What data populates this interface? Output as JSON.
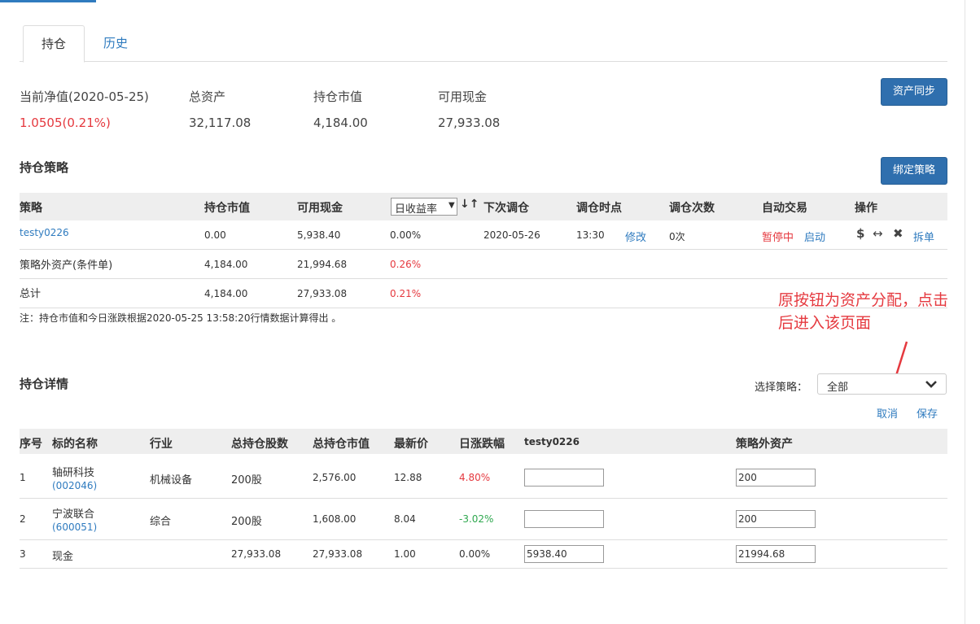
{
  "tabs": {
    "holding": "持仓",
    "history": "历史"
  },
  "summary": {
    "nav_label": "当前净值(2020-05-25)",
    "nav_value": "1.0505(0.21%)",
    "total_assets_label": "总资产",
    "total_assets_value": "32,117.08",
    "market_value_label": "持仓市值",
    "market_value_value": "4,184.00",
    "cash_label": "可用现金",
    "cash_value": "27,933.08"
  },
  "buttons": {
    "asset_sync": "资产同步",
    "bind_strategy": "绑定策略",
    "cancel": "取消",
    "save": "保存"
  },
  "strategy_section": {
    "title": "持仓策略",
    "headers": {
      "strategy": "策略",
      "market_value": "持仓市值",
      "cash": "可用现金",
      "daily_return": "日收益率",
      "next_rebalance": "下次调仓",
      "rebalance_time": "调仓时点",
      "rebalance_count": "调仓次数",
      "auto_trade": "自动交易",
      "action": "操作"
    },
    "sort_icon": "↓↑",
    "rows": [
      {
        "name": "testy0226",
        "market_value": "0.00",
        "cash": "5,938.40",
        "daily_return": "0.00%",
        "next_rebalance": "2020-05-26",
        "time": "13:30",
        "modify": "修改",
        "count": "0次",
        "paused": "暂停中",
        "start": "启动",
        "split": "拆单"
      },
      {
        "name": "策略外资产(条件单)",
        "market_value": "4,184.00",
        "cash": "21,994.68",
        "daily_return": "0.26%"
      },
      {
        "name": "总计",
        "market_value": "4,184.00",
        "cash": "27,933.08",
        "daily_return": "0.21%"
      }
    ],
    "note": "注：持仓市值和今日涨跌根据2020-05-25 13:58:20行情数据计算得出 。"
  },
  "annotation": {
    "line1": "原按钮为资产分配，点击",
    "line2": "后进入该页面"
  },
  "detail_section": {
    "title": "持仓详情",
    "select_label": "选择策略：",
    "select_value": "全部",
    "headers": {
      "index": "序号",
      "name": "标的名称",
      "industry": "行业",
      "shares": "总持仓股数",
      "market_value": "总持仓市值",
      "price": "最新价",
      "change": "日涨跌幅",
      "strategy": "testy0226",
      "outside": "策略外资产"
    },
    "rows": [
      {
        "index": "1",
        "name": "轴研科技",
        "code": "(002046)",
        "industry": "机械设备",
        "shares": "200股",
        "market_value": "2,576.00",
        "price": "12.88",
        "change": "4.80%",
        "strategy_input": "",
        "outside_input": "200"
      },
      {
        "index": "2",
        "name": "宁波联合",
        "code": "(600051)",
        "industry": "综合",
        "shares": "200股",
        "market_value": "1,608.00",
        "price": "8.04",
        "change": "-3.02%",
        "strategy_input": "",
        "outside_input": "200"
      },
      {
        "index": "3",
        "name": "现金",
        "code": "",
        "industry": "",
        "shares": "27,933.08",
        "market_value": "27,933.08",
        "price": "1.00",
        "change": "0.00%",
        "strategy_input": "5938.40",
        "outside_input": "21994.68"
      }
    ]
  },
  "colors": {
    "accent": "#2f7bbf",
    "button": "#2f6fae",
    "positive": "#e5393f",
    "negative": "#2fa84f",
    "header_bg": "#eeeeee"
  }
}
